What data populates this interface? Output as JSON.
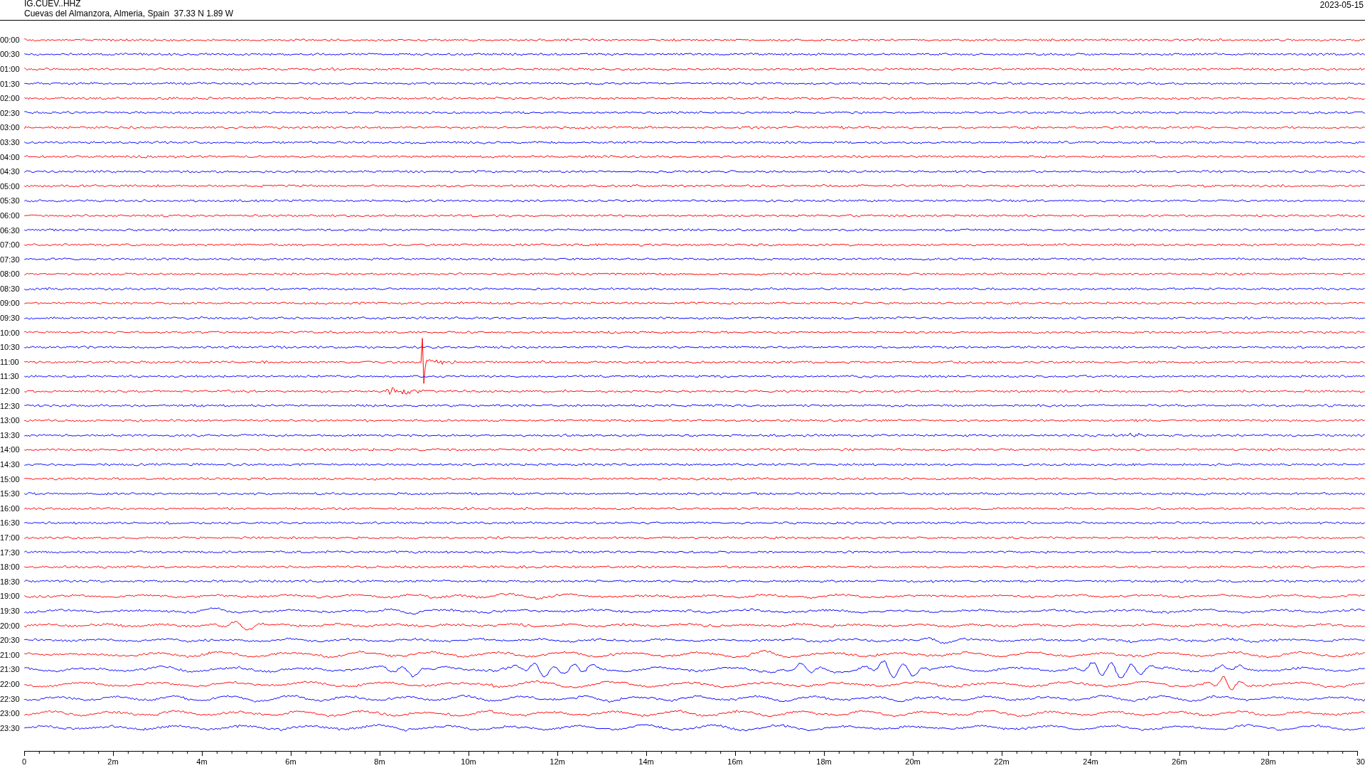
{
  "station": {
    "code": "IG.CUEV..HHZ",
    "location": "Cuevas del Almanzora, Almeria, Spain  37.33 N 1.89 W",
    "date": "2023-05-15"
  },
  "traces": [
    {
      "time": "00:00",
      "color": "#ff0000"
    },
    {
      "time": "00:30",
      "color": "#0000ff"
    },
    {
      "time": "01:00",
      "color": "#ff0000"
    },
    {
      "time": "01:30",
      "color": "#0000ff"
    },
    {
      "time": "02:00",
      "color": "#ff0000"
    },
    {
      "time": "02:30",
      "color": "#0000ff"
    },
    {
      "time": "03:00",
      "color": "#ff0000"
    },
    {
      "time": "03:30",
      "color": "#0000ff"
    },
    {
      "time": "04:00",
      "color": "#ff0000"
    },
    {
      "time": "04:30",
      "color": "#0000ff"
    },
    {
      "time": "05:00",
      "color": "#ff0000"
    },
    {
      "time": "05:30",
      "color": "#0000ff"
    },
    {
      "time": "06:00",
      "color": "#ff0000"
    },
    {
      "time": "06:30",
      "color": "#0000ff"
    },
    {
      "time": "07:00",
      "color": "#ff0000"
    },
    {
      "time": "07:30",
      "color": "#0000ff"
    },
    {
      "time": "08:00",
      "color": "#ff0000"
    },
    {
      "time": "08:30",
      "color": "#0000ff"
    },
    {
      "time": "09:00",
      "color": "#ff0000"
    },
    {
      "time": "09:30",
      "color": "#0000ff"
    },
    {
      "time": "10:00",
      "color": "#ff0000"
    },
    {
      "time": "10:30",
      "color": "#0000ff"
    },
    {
      "time": "11:00",
      "color": "#ff0000"
    },
    {
      "time": "11:30",
      "color": "#0000ff"
    },
    {
      "time": "12:00",
      "color": "#ff0000"
    },
    {
      "time": "12:30",
      "color": "#0000ff"
    },
    {
      "time": "13:00",
      "color": "#ff0000"
    },
    {
      "time": "13:30",
      "color": "#0000ff"
    },
    {
      "time": "14:00",
      "color": "#ff0000"
    },
    {
      "time": "14:30",
      "color": "#0000ff"
    },
    {
      "time": "15:00",
      "color": "#ff0000"
    },
    {
      "time": "15:30",
      "color": "#0000ff"
    },
    {
      "time": "16:00",
      "color": "#ff0000"
    },
    {
      "time": "16:30",
      "color": "#0000ff"
    },
    {
      "time": "17:00",
      "color": "#ff0000"
    },
    {
      "time": "17:30",
      "color": "#0000ff"
    },
    {
      "time": "18:00",
      "color": "#ff0000"
    },
    {
      "time": "18:30",
      "color": "#0000ff"
    },
    {
      "time": "19:00",
      "color": "#ff0000"
    },
    {
      "time": "19:30",
      "color": "#0000ff"
    },
    {
      "time": "20:00",
      "color": "#ff0000"
    },
    {
      "time": "20:30",
      "color": "#0000ff"
    },
    {
      "time": "21:00",
      "color": "#ff0000"
    },
    {
      "time": "21:30",
      "color": "#0000ff"
    },
    {
      "time": "22:00",
      "color": "#ff0000"
    },
    {
      "time": "22:30",
      "color": "#0000ff"
    },
    {
      "time": "23:00",
      "color": "#ff0000"
    },
    {
      "time": "23:30",
      "color": "#0000ff"
    }
  ],
  "time_axis": {
    "ticks": [
      "0",
      "2m",
      "4m",
      "6m",
      "8m",
      "10m",
      "12m",
      "14m",
      "16m",
      "18m",
      "20m",
      "22m",
      "24m",
      "26m",
      "28m",
      "30"
    ]
  }
}
